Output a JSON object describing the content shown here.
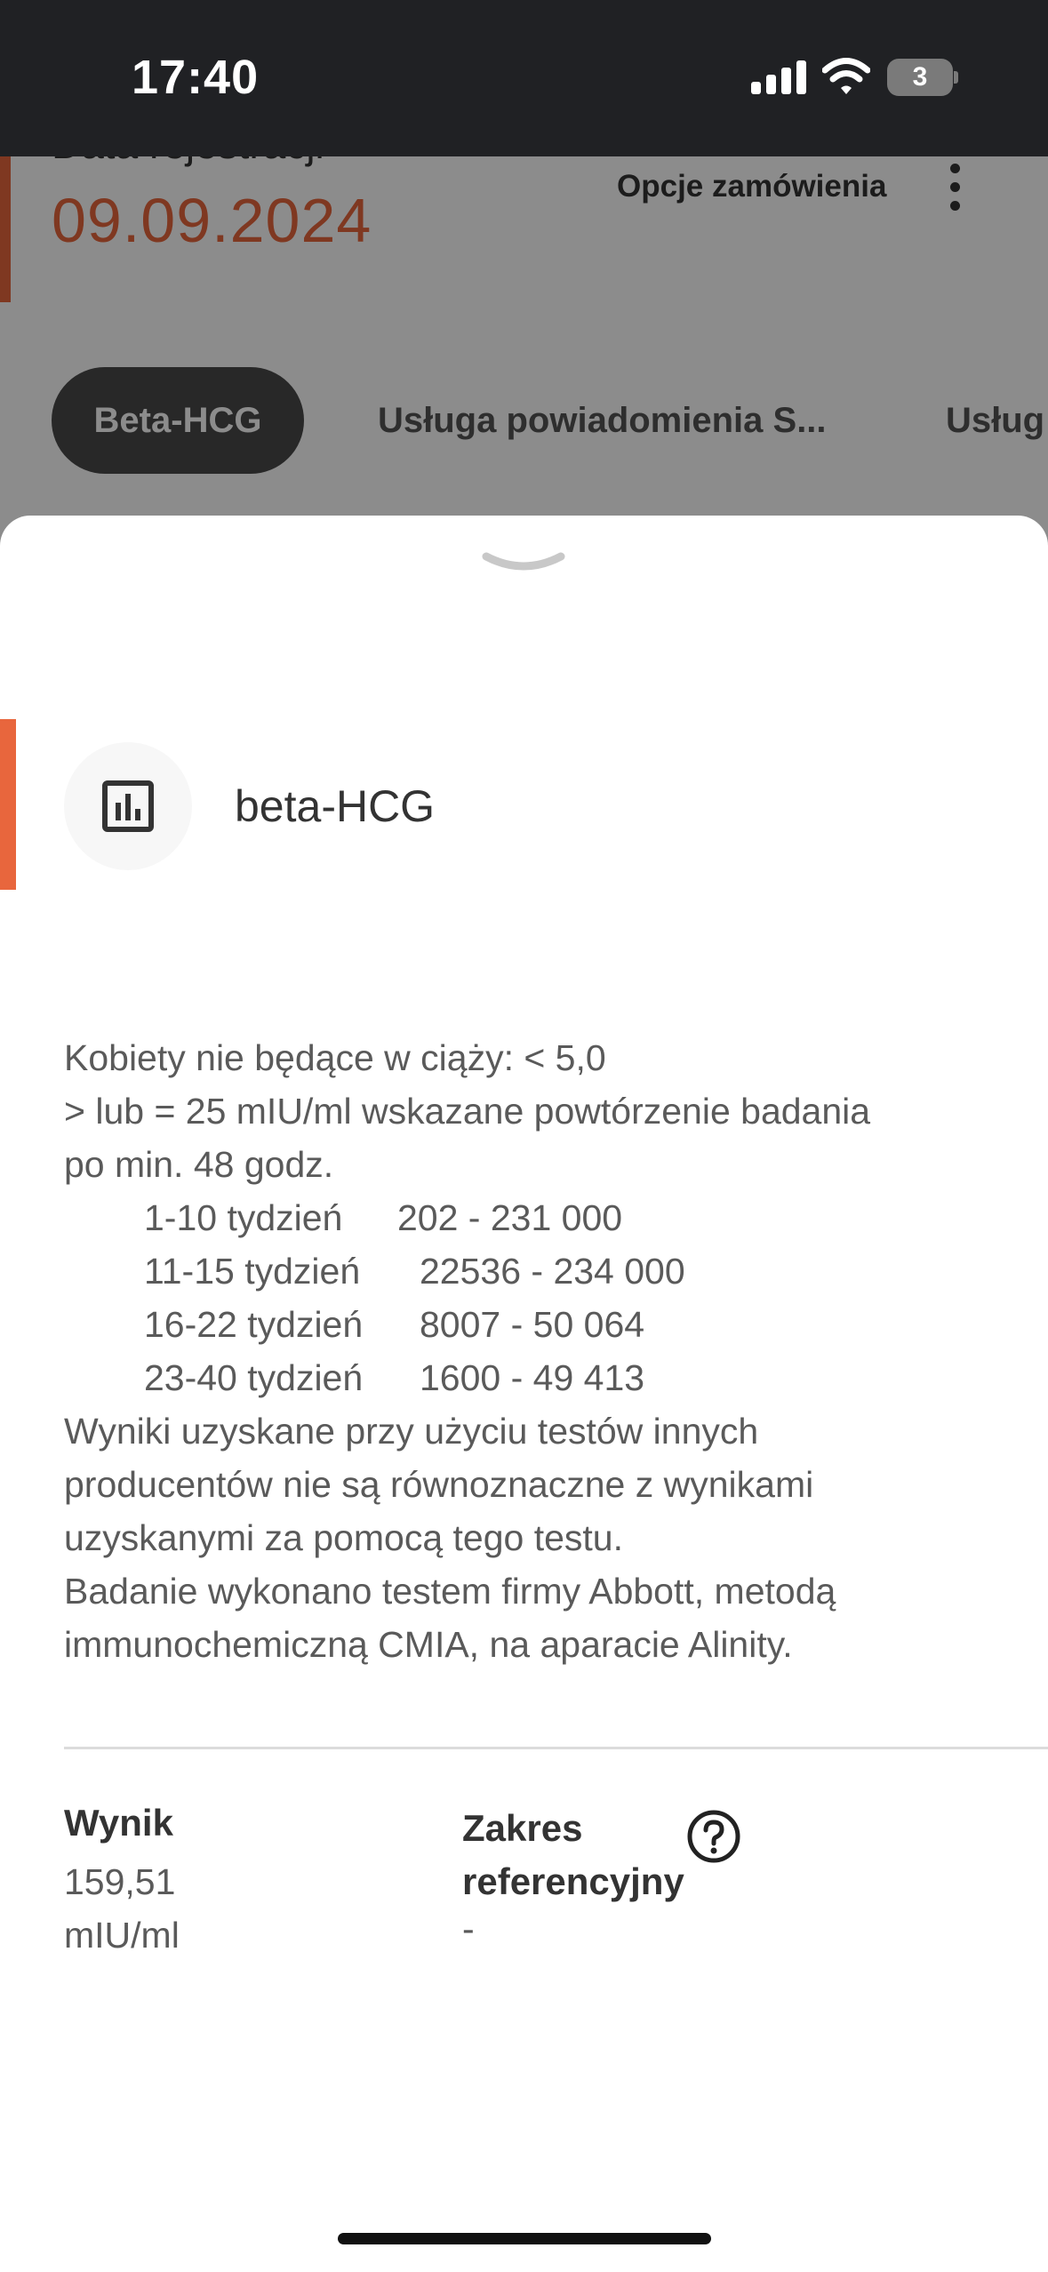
{
  "status_bar": {
    "time": "17:40",
    "battery_level": "3",
    "icons": [
      "signal-icon",
      "wifi-icon",
      "battery-icon"
    ]
  },
  "background_page": {
    "registration_label": "Data rejestracji",
    "registration_date": "09.09.2024",
    "order_options": "Opcje zamówienia",
    "tabs": [
      {
        "label": "Beta-HCG",
        "active": true
      },
      {
        "label": "Usługa powiadomienia S...",
        "active": false
      },
      {
        "label": "Usług",
        "active": false
      }
    ]
  },
  "sheet": {
    "icon": "chart-icon",
    "title": "beta-HCG",
    "description": {
      "line1": "Kobiety nie będące w ciąży: < 5,0",
      "line2": "> lub = 25 mIU/ml wskazane powtórzenie badania",
      "line3": "po min. 48 godz.",
      "ranges": [
        {
          "week": "1-10 tydzień",
          "range": "202 - 231 000"
        },
        {
          "week": "11-15 tydzień",
          "range": "22536 - 234 000"
        },
        {
          "week": "16-22 tydzień",
          "range": "8007 - 50 064"
        },
        {
          "week": "23-40 tydzień",
          "range": "1600 - 49 413"
        }
      ],
      "line4": "Wyniki uzyskane przy użyciu testów innych",
      "line5": "producentów nie są równoznaczne z wynikami",
      "line6": "uzyskanymi za pomocą tego testu.",
      "line7": "Badanie wykonano testem firmy Abbott, metodą",
      "line8": "immunochemiczną CMIA, na aparacie Alinity."
    },
    "result": {
      "label": "Wynik",
      "value": "159,51",
      "unit": "mIU/ml"
    },
    "reference": {
      "label_line1": "Zakres",
      "label_line2": "referencyjny",
      "value": "-"
    },
    "help_icon": "help-circle-icon"
  },
  "colors": {
    "accent": "#e8663d",
    "status_bar": "#202124",
    "chip_active": "#4a4a4a"
  }
}
